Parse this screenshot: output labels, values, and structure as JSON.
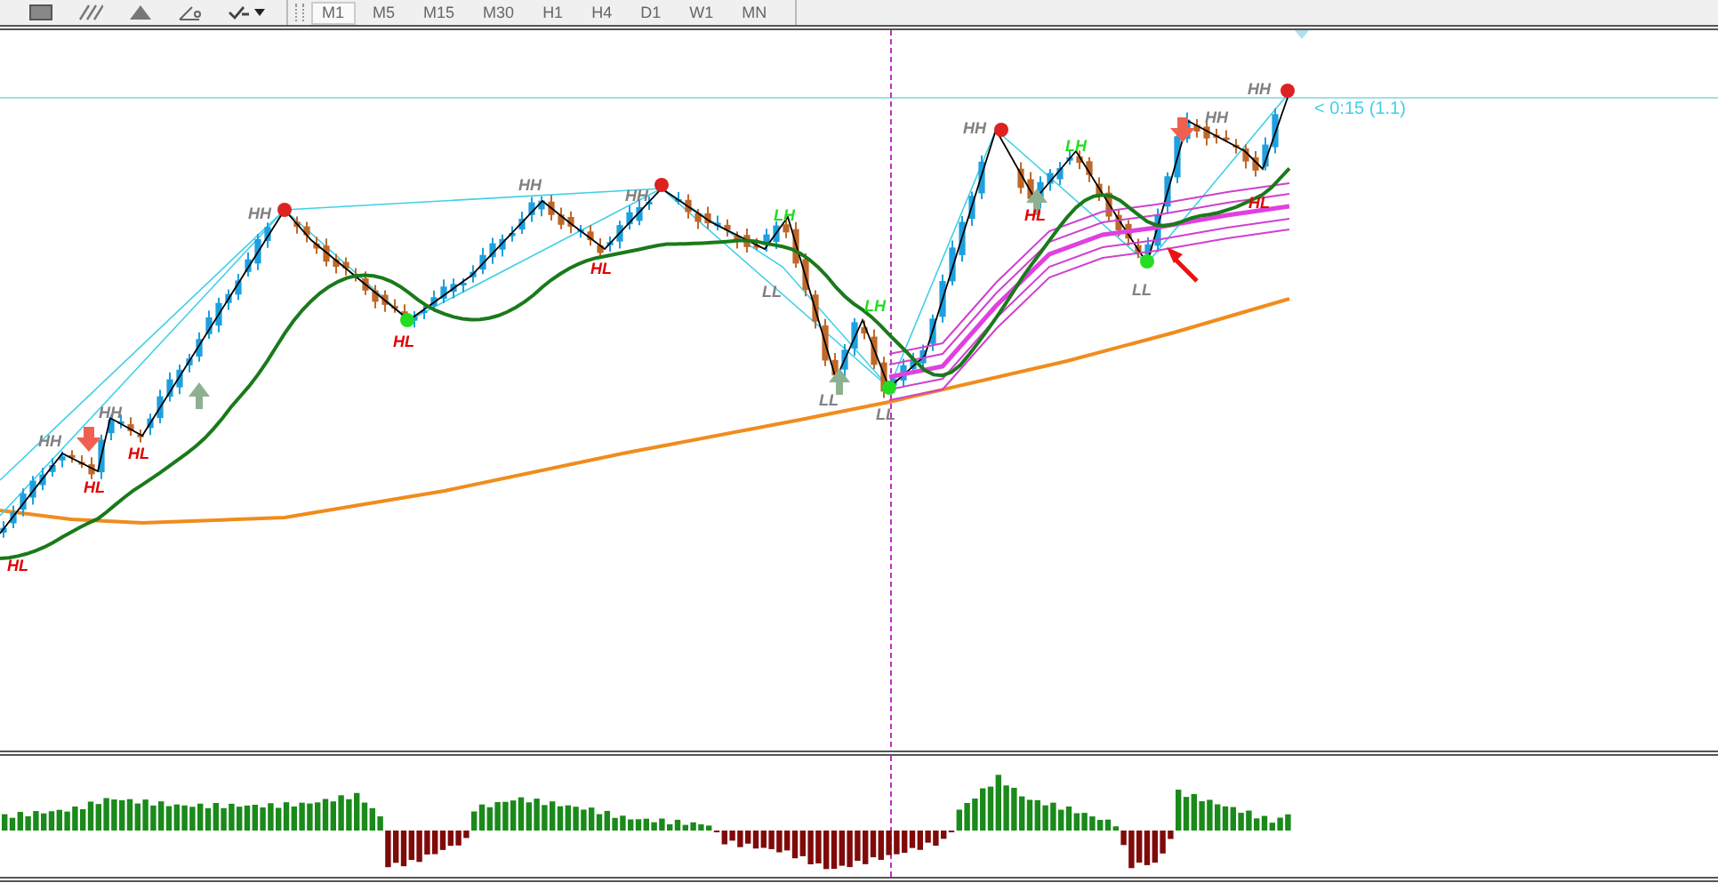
{
  "toolbar": {
    "timeframes": [
      {
        "label": "M1",
        "selected": true
      },
      {
        "label": "M5",
        "selected": false
      },
      {
        "label": "M15",
        "selected": false
      },
      {
        "label": "M30",
        "selected": false
      },
      {
        "label": "H1",
        "selected": false
      },
      {
        "label": "H4",
        "selected": false
      },
      {
        "label": "D1",
        "selected": false
      },
      {
        "label": "W1",
        "selected": false
      },
      {
        "label": "MN",
        "selected": false
      }
    ]
  },
  "chart": {
    "countdown": "< 0:15 (1.1)",
    "pattern_labels": [
      {
        "text": "HL",
        "color": "#e00000"
      },
      {
        "text": "HH",
        "color": "#808080"
      },
      {
        "text": "HL",
        "color": "#e00000"
      },
      {
        "text": "HH",
        "color": "#808080"
      },
      {
        "text": "HL",
        "color": "#e00000"
      },
      {
        "text": "HH",
        "color": "#808080"
      },
      {
        "text": "HL",
        "color": "#e00000"
      },
      {
        "text": "HH",
        "color": "#808080"
      },
      {
        "text": "HL",
        "color": "#e00000"
      },
      {
        "text": "HH",
        "color": "#808080"
      },
      {
        "text": "LH",
        "color": "#22dd22"
      },
      {
        "text": "LL",
        "color": "#808080"
      },
      {
        "text": "LH",
        "color": "#22dd22"
      },
      {
        "text": "LL",
        "color": "#808080"
      },
      {
        "text": "LL",
        "color": "#808080"
      },
      {
        "text": "HH",
        "color": "#808080"
      },
      {
        "text": "HL",
        "color": "#e00000"
      },
      {
        "text": "LH",
        "color": "#22dd22"
      },
      {
        "text": "LL",
        "color": "#808080"
      },
      {
        "text": "HH",
        "color": "#808080"
      },
      {
        "text": "HL",
        "color": "#e00000"
      },
      {
        "text": "HH",
        "color": "#808080"
      }
    ]
  }
}
